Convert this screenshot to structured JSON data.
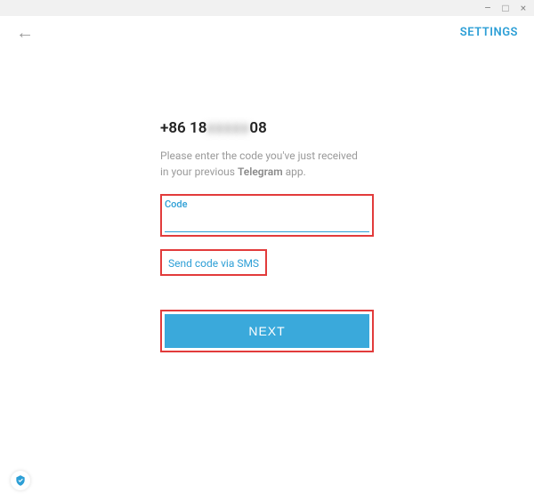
{
  "window": {
    "minimize": "–",
    "maximize": "□",
    "close": "×"
  },
  "topbar": {
    "back_glyph": "←",
    "settings_label": "SETTINGS"
  },
  "verify": {
    "phone_prefix": "+86 18",
    "phone_hidden": "xxxxx",
    "phone_suffix": "08",
    "instruction_line1": "Please enter the code you've just received",
    "instruction_line2_a": "in your previous ",
    "instruction_appname": "Telegram",
    "instruction_line2_b": " app.",
    "code_label": "Code",
    "code_value": "",
    "sms_link": "Send code via SMS",
    "next_label": "NEXT"
  }
}
